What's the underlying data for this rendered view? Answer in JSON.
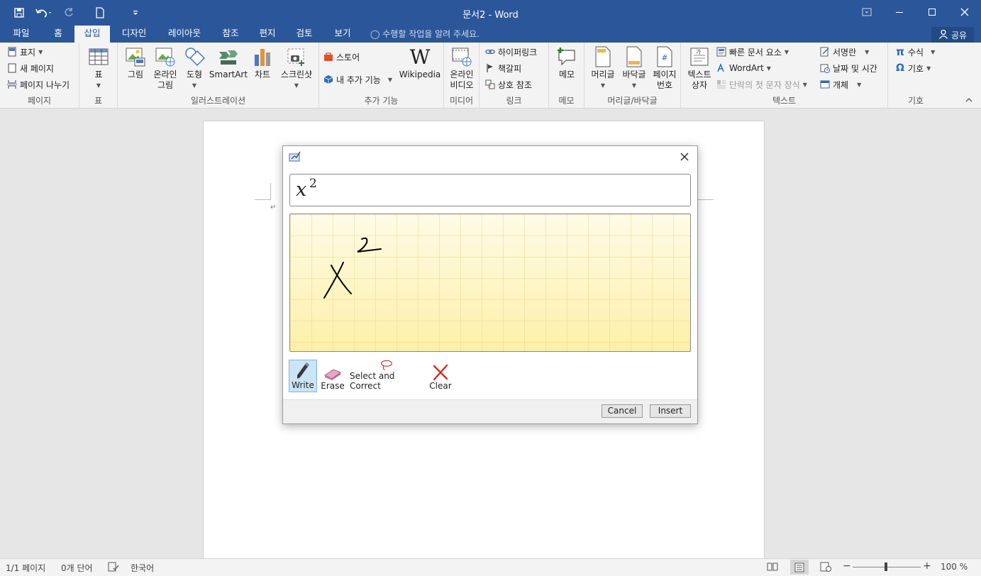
{
  "window": {
    "title": "문서2 - Word"
  },
  "tabs": [
    "파일",
    "홈",
    "삽입",
    "디자인",
    "레이아웃",
    "참조",
    "편지",
    "검토",
    "보기"
  ],
  "active_tab": "삽입",
  "tellme": "수행할 작업을 알려 주세요.",
  "share": "공유",
  "ribbon": {
    "pages": {
      "items": [
        "표지",
        "새 페이지",
        "페이지 나누기"
      ],
      "label": "페이지"
    },
    "tables": {
      "btn": "표",
      "label": "표"
    },
    "illustrations": {
      "btn1a": "그림",
      "btn2a": "온라인",
      "btn2b": "그림",
      "btn3a": "도형",
      "btn4a": "SmartArt",
      "btn5a": "차트",
      "btn6a": "스크린샷",
      "label": "일러스트레이션"
    },
    "addins": {
      "store": "스토어",
      "myaddins": "내 추가 기능",
      "wikipedia": "Wikipedia",
      "label": "추가 기능"
    },
    "media": {
      "btn_a": "온라인",
      "btn_b": "비디오",
      "label": "미디어"
    },
    "links": {
      "hyperlink": "하이퍼링크",
      "bookmark": "책갈피",
      "crossref": "상호 참조",
      "label": "링크"
    },
    "comments": {
      "btn": "메모",
      "label": "메모"
    },
    "headerfooter": {
      "header": "머리글",
      "footer": "바닥글",
      "pagenum_a": "페이지",
      "pagenum_b": "번호",
      "label": "머리글/바닥글"
    },
    "text": {
      "textbox_a": "텍스트",
      "textbox_b": "상자",
      "quickparts": "빠른 문서 요소",
      "wordart": "WordArt",
      "dropcap": "단락의 첫 문자 장식",
      "signature": "서명란",
      "datetime": "날짜 및 시간",
      "object": "개체",
      "label": "텍스트"
    },
    "symbols": {
      "equation": "수식",
      "symbol": "기호",
      "label": "기호"
    }
  },
  "dialog": {
    "preview_base": "x",
    "preview_exp": "2",
    "tools": [
      "Write",
      "Erase",
      "Select and Correct",
      "Clear"
    ],
    "cancel": "Cancel",
    "insert": "Insert"
  },
  "statusbar": {
    "page": "1/1 페이지",
    "words": "0개 단어",
    "lang": "한국어",
    "zoom": "100 %"
  },
  "colors": {
    "accent": "#2b579a"
  }
}
